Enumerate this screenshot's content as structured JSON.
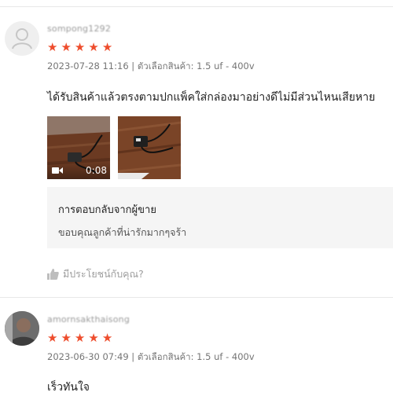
{
  "reviews": [
    {
      "username": "sompong1292",
      "rating": 5,
      "stars": [
        "★",
        "★",
        "★",
        "★",
        "★"
      ],
      "date": "2023-07-28 11:16",
      "variation": "ตัวเลือกสินค้า: 1.5 uf - 400v",
      "text": "ได้รับสินค้าแล้วตรงตามปกแพ็คใส่กล่องมาอย่างดีไม่มีส่วนไหนเสียหาย",
      "video_duration": "0:08",
      "seller_reply_title": "การตอบกลับจากผู้ขาย",
      "seller_reply_text": "ขอบคุณลูกค้าที่น่ารักมากๆจร้า",
      "helpful_label": "มีประโยชน์กับคุณ?"
    },
    {
      "username": "amornsakthaisong",
      "rating": 5,
      "stars": [
        "★",
        "★",
        "★",
        "★",
        "★"
      ],
      "date": "2023-06-30 07:49",
      "variation": "ตัวเลือกสินค้า: 1.5 uf - 400v",
      "text": "เร็วทันใจ"
    }
  ],
  "separator": " | ",
  "colors": {
    "star": "#ee4d2d",
    "reply_bg": "#f5f5f5",
    "meta": "#757575"
  }
}
